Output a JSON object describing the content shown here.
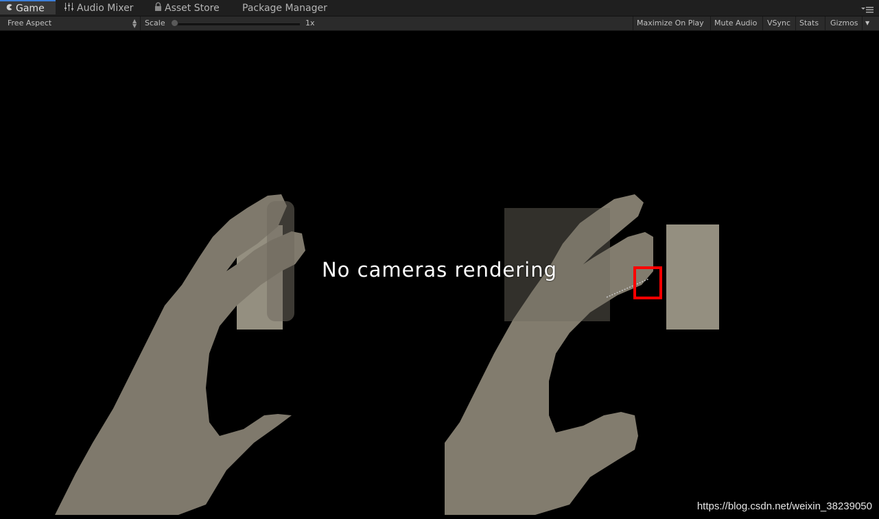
{
  "tabs": [
    {
      "label": "Game",
      "icon": "game-icon",
      "active": true
    },
    {
      "label": "Audio Mixer",
      "icon": "mixer-icon",
      "active": false
    },
    {
      "label": "Asset Store",
      "icon": "lock-icon",
      "active": false
    },
    {
      "label": "Package Manager",
      "icon": "",
      "active": false
    }
  ],
  "toolbar": {
    "aspect": "Free Aspect",
    "scale_label": "Scale",
    "scale_value": "1x",
    "maximize_on_play": "Maximize On Play",
    "mute_audio": "Mute Audio",
    "vsync": "VSync",
    "stats": "Stats",
    "gizmos": "Gizmos"
  },
  "viewport": {
    "message": "No cameras rendering",
    "watermark": "https://blog.csdn.net/weixin_38239050"
  },
  "colors": {
    "hand": "#7e786a",
    "panel": "#948f80",
    "highlight_box": "#ff0000",
    "tab_accent": "#3d7fd9"
  }
}
